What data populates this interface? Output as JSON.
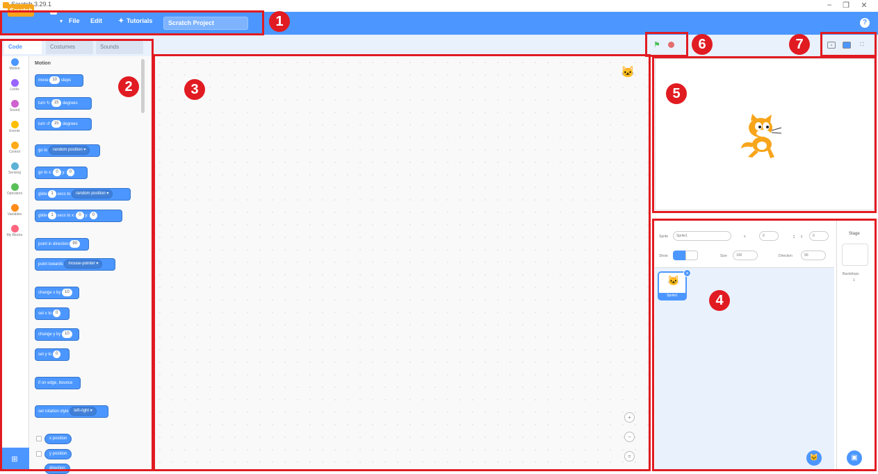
{
  "window": {
    "title": "Scratch 3.29.1",
    "controls": [
      "–",
      "❐",
      "✕"
    ]
  },
  "menubar": {
    "logo": "Scratch",
    "file": "File",
    "edit": "Edit",
    "tutorials": "Tutorials",
    "project_title": "Scratch Project"
  },
  "tabs": [
    "Code",
    "Costumes",
    "Sounds"
  ],
  "categories": [
    {
      "label": "Motion",
      "color": "#4c97ff"
    },
    {
      "label": "Looks",
      "color": "#9966ff"
    },
    {
      "label": "Sound",
      "color": "#cf63cf"
    },
    {
      "label": "Events",
      "color": "#ffbf00"
    },
    {
      "label": "Control",
      "color": "#ffab19"
    },
    {
      "label": "Sensing",
      "color": "#5cb1d6"
    },
    {
      "label": "Operators",
      "color": "#59c059"
    },
    {
      "label": "Variables",
      "color": "#ff8c1a"
    },
    {
      "label": "My Blocks",
      "color": "#ff6680"
    }
  ],
  "palette": {
    "heading": "Motion",
    "blocks": {
      "move": "move",
      "move_val": "10",
      "move_unit": "steps",
      "turn_r": "turn ↻",
      "turn_r_val": "15",
      "turn_r_unit": "degrees",
      "turn_l": "turn ↺",
      "turn_l_val": "15",
      "turn_l_unit": "degrees",
      "goto": "go to",
      "goto_opt": "random position ▾",
      "gotoxy": "go to x:",
      "gotoxy_x": "0",
      "gotoxy_y_lab": "y:",
      "gotoxy_y": "0",
      "glide": "glide",
      "glide_val": "1",
      "glide_mid": "secs to",
      "glide_opt": "random position ▾",
      "glidexy": "glide",
      "glidexy_val": "1",
      "glidexy_mid": "secs to x:",
      "glidexy_x": "0",
      "glidexy_y_lab": "y:",
      "glidexy_y": "0",
      "point": "point in direction",
      "point_val": "90",
      "pointto": "point towards",
      "pointto_opt": "mouse-pointer ▾",
      "changex": "change x by",
      "changex_val": "10",
      "setx": "set x to",
      "setx_val": "0",
      "changey": "change y by",
      "changey_val": "10",
      "sety": "set y to",
      "sety_val": "0",
      "bounce": "if on edge, bounce",
      "rotstyle": "set rotation style",
      "rotstyle_opt": "left-right ▾",
      "xpos": "x position",
      "ypos": "y position",
      "dir": "direction"
    }
  },
  "sprite_info": {
    "sprite_label": "Sprite",
    "sprite_name": "Sprite1",
    "x_label": "x",
    "x_val": "0",
    "y_label": "y",
    "y_val": "0",
    "show_label": "Show",
    "size_label": "Size",
    "size_val": "100",
    "direction_label": "Direction",
    "direction_val": "90"
  },
  "sprite_tile": {
    "name": "Sprite1"
  },
  "stage_pane": {
    "title": "Stage",
    "backdrops_label": "Backdrops",
    "backdrops_count": "1"
  },
  "markers": [
    "1",
    "2",
    "3",
    "4",
    "5",
    "6",
    "7"
  ]
}
